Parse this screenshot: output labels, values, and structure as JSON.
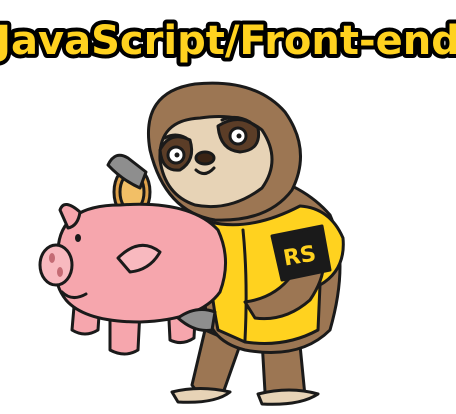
{
  "headline": {
    "text": "JavaScript/Front-end",
    "fill_color": "#FFD21F",
    "outline_color": "#000000"
  },
  "shirt_logo": {
    "text": "RS"
  },
  "illustration": {
    "subject": "sloth-mascot-icon",
    "prop": "piggy-bank-icon",
    "colors": {
      "fur": "#9C7653",
      "shirt": "#FFD21F",
      "pig": "#F6A6AD",
      "coin": "#E0A24A"
    }
  }
}
